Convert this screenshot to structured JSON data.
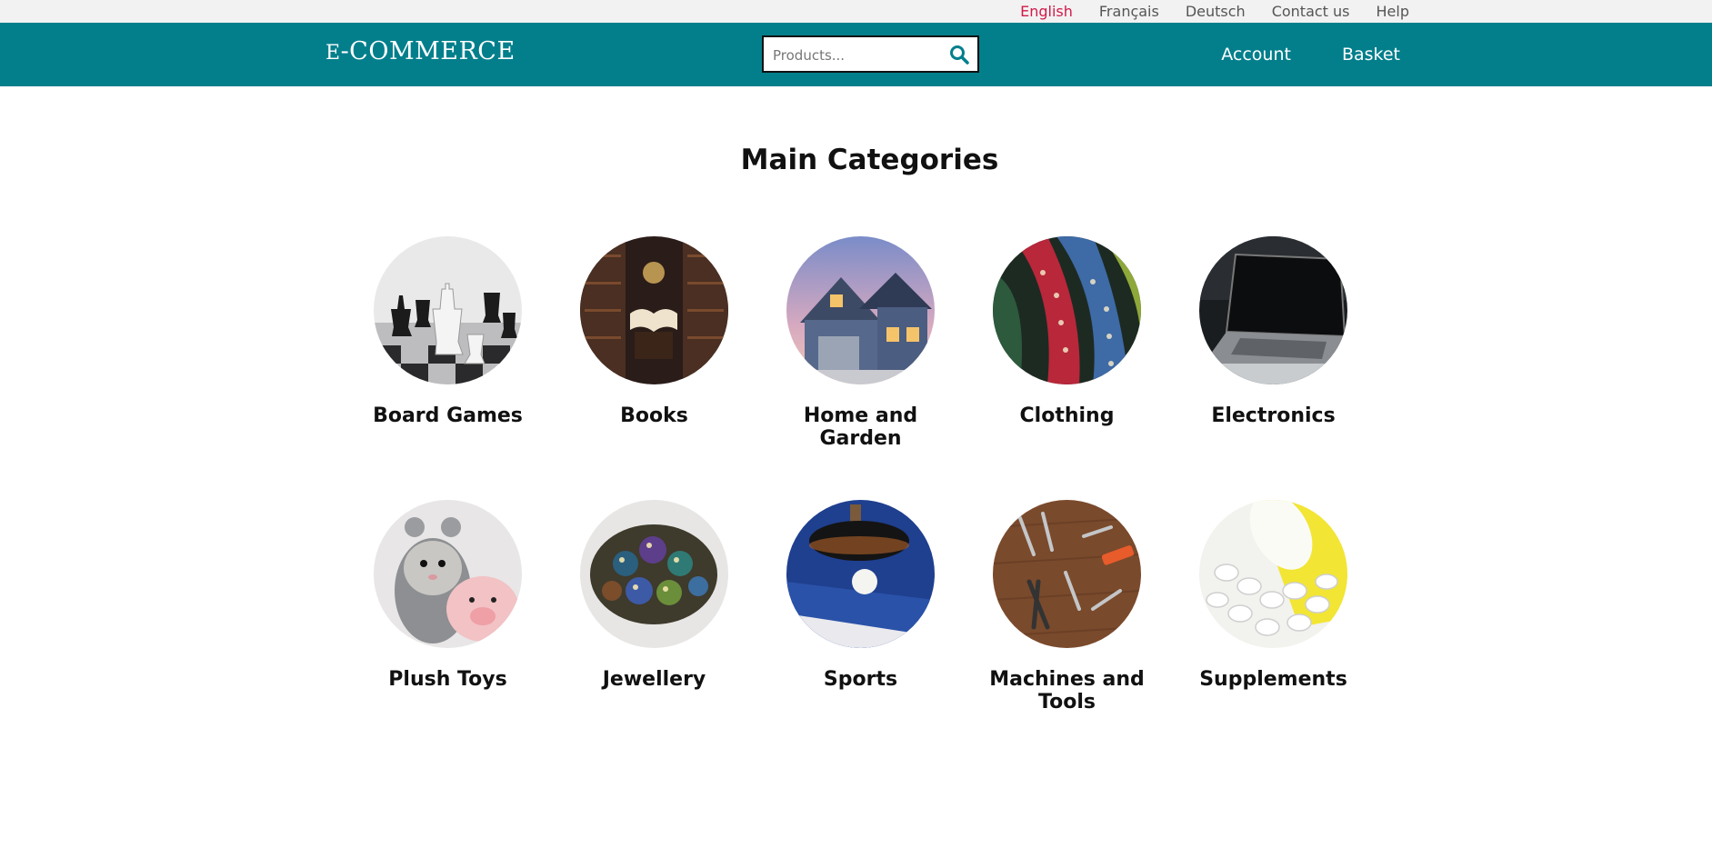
{
  "top_links": [
    "English",
    "Français",
    "Deutsch",
    "Contact us",
    "Help"
  ],
  "active_language": "English",
  "header": {
    "logo_prefix": "E",
    "logo_rest": "-COMMERCE",
    "search_placeholder": "Products...",
    "nav": [
      "Account",
      "Basket"
    ]
  },
  "main": {
    "title": "Main Categories",
    "categories": [
      {
        "label": "Board Games",
        "image": "chess-pieces"
      },
      {
        "label": "Books",
        "image": "library-open-book"
      },
      {
        "label": "Home and Garden",
        "image": "house"
      },
      {
        "label": "Clothing",
        "image": "ties"
      },
      {
        "label": "Electronics",
        "image": "laptop"
      },
      {
        "label": "Plush Toys",
        "image": "plush-hamster-pig"
      },
      {
        "label": "Jewellery",
        "image": "gemstones"
      },
      {
        "label": "Sports",
        "image": "ping-pong"
      },
      {
        "label": "Machines and Tools",
        "image": "tools"
      },
      {
        "label": "Supplements",
        "image": "pills"
      }
    ]
  },
  "colors": {
    "header_bg": "#037f8c",
    "topbar_bg": "#f2f2f2",
    "active_link": "#d11a4a",
    "search_icon": "#037f8c"
  }
}
